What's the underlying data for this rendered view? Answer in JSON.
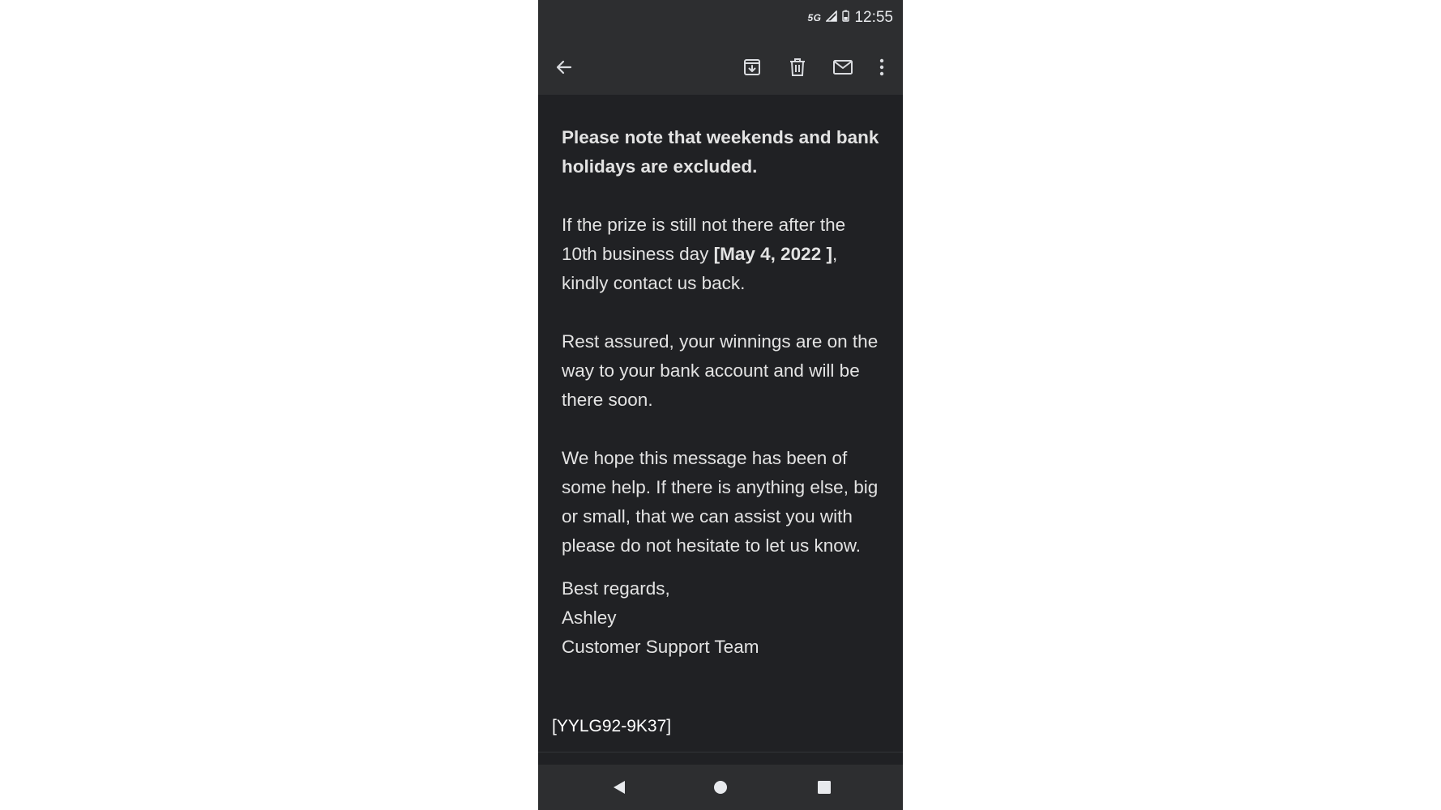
{
  "status_bar": {
    "network": "5G",
    "time": "12:55"
  },
  "toolbar": {
    "back_icon": "arrow-left-icon",
    "archive_icon": "archive-icon",
    "delete_icon": "trash-icon",
    "mark_unread_icon": "mail-icon",
    "more_icon": "more-vertical-icon"
  },
  "email": {
    "paragraph_1": "Please note that weekends and bank holidays are excluded.",
    "paragraph_2_pre": "If the prize is still not there after the 10th business day ",
    "paragraph_2_bold": "[May 4,  2022 ]",
    "paragraph_2_post": ", kindly contact us back.",
    "paragraph_3": "Rest assured, your winnings are on the way to your bank account and will be there soon.",
    "paragraph_4": "We hope this message has been of some help. If there is anything else, big or small, that we can assist you with please do not hesitate to let us know.",
    "signoff": "Best regards,",
    "signature_name": "Ashley",
    "signature_team": "Customer Support Team",
    "reference": "[YYLG92-9K37]"
  },
  "nav_bar": {
    "back_icon": "triangle-back-icon",
    "home_icon": "circle-home-icon",
    "recents_icon": "square-recents-icon"
  },
  "colors": {
    "background": "#202124",
    "bar": "#2d2e30",
    "text": "#e3e3e3"
  }
}
